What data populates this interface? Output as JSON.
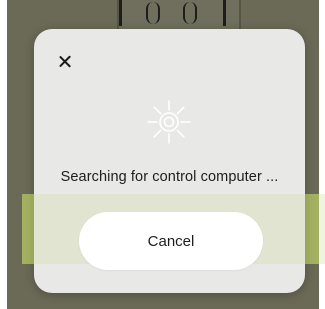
{
  "dialog": {
    "close_icon": "close-icon",
    "status_icon": "searching-sun-icon",
    "status_text": "Searching for control computer ...",
    "cancel_label": "Cancel"
  },
  "colors": {
    "backdrop": "#6b6a57",
    "dialog_background": "#e8e8e6",
    "button_background": "#ffffff",
    "background_accent_bar": "#8a9a3a",
    "text": "#1d1d1d"
  }
}
